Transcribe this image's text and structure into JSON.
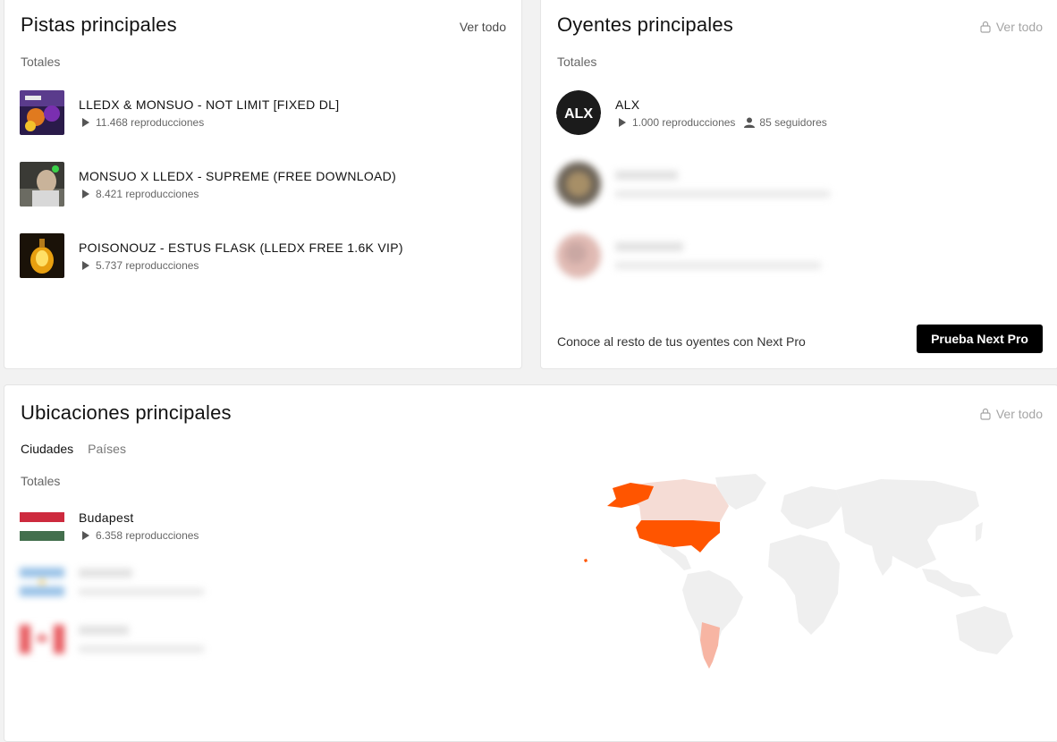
{
  "tracks_card": {
    "title": "Pistas principales",
    "see_all": "Ver todo",
    "totals": "Totales",
    "items": [
      {
        "title": "LLEDX & MONSUO - NOT LIMIT [FIXED DL]",
        "plays": "11.468 reproducciones"
      },
      {
        "title": "MONSUO X LLEDX - SUPREME (FREE DOWNLOAD)",
        "plays": "8.421 reproducciones"
      },
      {
        "title": "POISONOUZ - ESTUS FLASK (LLEDX FREE 1.6K VIP)",
        "plays": "5.737 reproducciones"
      }
    ]
  },
  "listeners_card": {
    "title": "Oyentes principales",
    "see_all": "Ver todo",
    "totals": "Totales",
    "items": [
      {
        "name": "ALX",
        "avatar_text": "ALX",
        "plays": "1.000 reproducciones",
        "followers": "85 seguidores"
      }
    ],
    "promo_text": "Conoce al resto de tus oyentes con Next Pro",
    "promo_button": "Prueba Next Pro"
  },
  "locations_card": {
    "title": "Ubicaciones principales",
    "see_all": "Ver todo",
    "tabs": [
      "Ciudades",
      "Países"
    ],
    "totals": "Totales",
    "items": [
      {
        "city": "Budapest",
        "plays": "6.358 reproducciones",
        "flag": "hungary"
      }
    ],
    "map_colors": {
      "highlight": "#ff5500",
      "medium": "#f7b5a3",
      "light": "#f5dcd5",
      "base": "#efefef"
    }
  }
}
